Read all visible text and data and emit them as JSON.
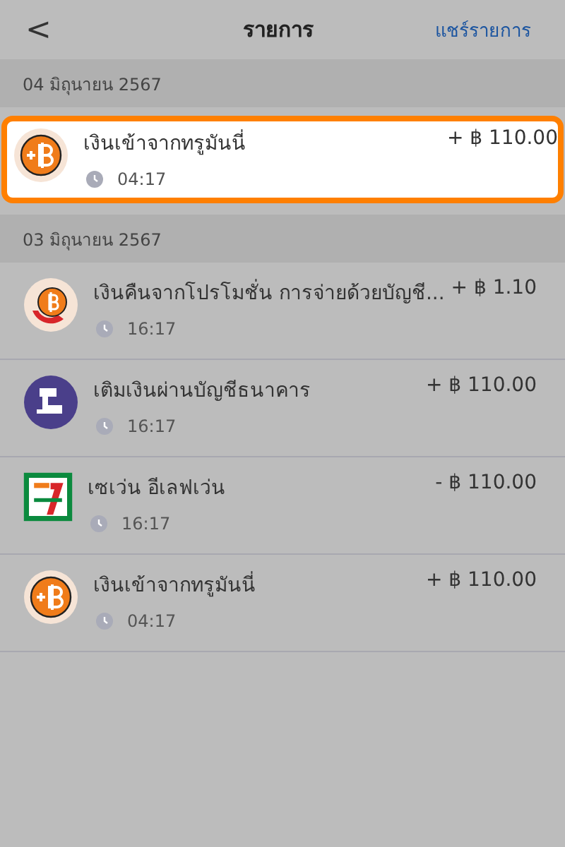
{
  "header": {
    "back": "<",
    "title": "รายการ",
    "share": "แชร์รายการ"
  },
  "sections": [
    {
      "date": "04 มิถุนายน 2567",
      "items": [
        {
          "kind": "topup",
          "name": "เงินเข้าจากทรูมันนี่",
          "time": "04:17",
          "amount": "+ ฿ 110.00",
          "highlighted": true
        }
      ]
    },
    {
      "date": "03 มิถุนายน 2567",
      "items": [
        {
          "kind": "cashback",
          "name": "เงินคืนจากโปรโมชั่น การจ่ายด้วยบัญชี...",
          "time": "16:17",
          "amount": "+ ฿ 1.10",
          "highlighted": false
        },
        {
          "kind": "bank",
          "name": "เติมเงินผ่านบัญชีธนาคาร",
          "time": "16:17",
          "amount": "+ ฿ 110.00",
          "highlighted": false
        },
        {
          "kind": "store",
          "name": "เซเว่น อีเลฟเว่น",
          "time": "16:17",
          "amount": "- ฿ 110.00",
          "highlighted": false
        },
        {
          "kind": "topup",
          "name": "เงินเข้าจากทรูมันนี่",
          "time": "04:17",
          "amount": "+ ฿ 110.00",
          "highlighted": false
        }
      ]
    }
  ]
}
